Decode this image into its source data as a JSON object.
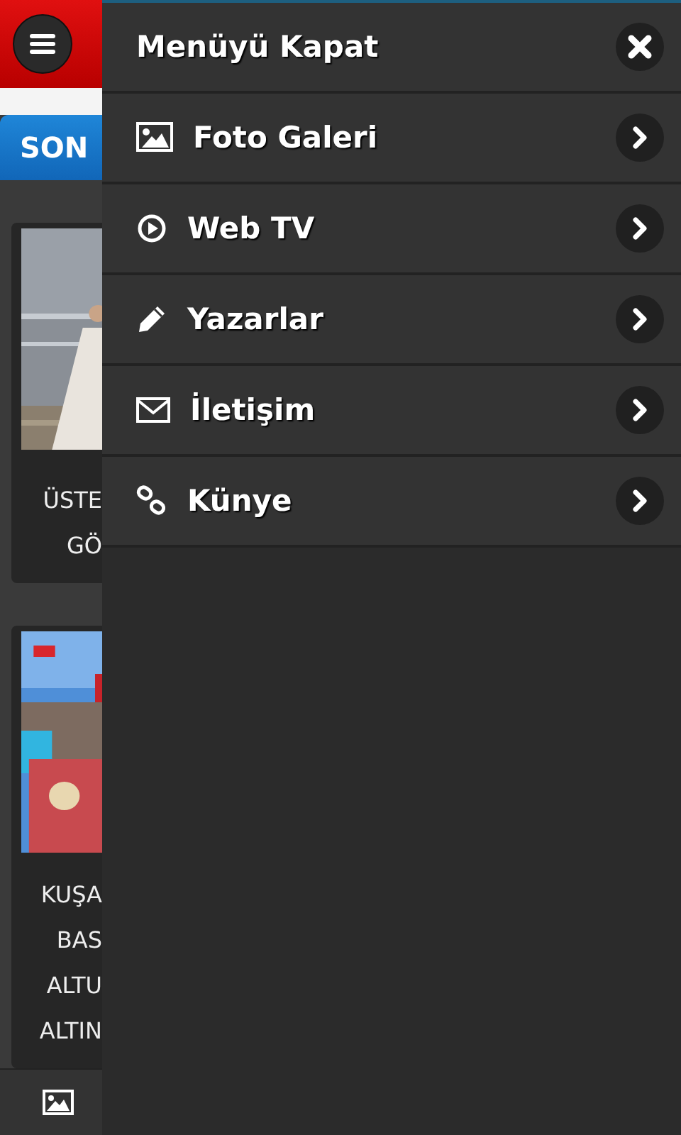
{
  "header": {
    "tab": "SON"
  },
  "cards": [
    {
      "lines": [
        "ÜSTE",
        "GÖ"
      ],
      "kind": "picture"
    },
    {
      "lines": [
        "KUŞA",
        "BAS",
        "ALTU",
        "ALTIN"
      ],
      "kind": "picture"
    }
  ],
  "menu": {
    "title": "Menüyü Kapat",
    "items": [
      {
        "label": "Foto Galeri",
        "kind": "gallery"
      },
      {
        "label": "Web TV",
        "kind": "video"
      },
      {
        "label": "Yazarlar",
        "kind": "pencil"
      },
      {
        "label": "İletişim",
        "kind": "mail"
      },
      {
        "label": "Künye",
        "kind": "link"
      }
    ]
  }
}
